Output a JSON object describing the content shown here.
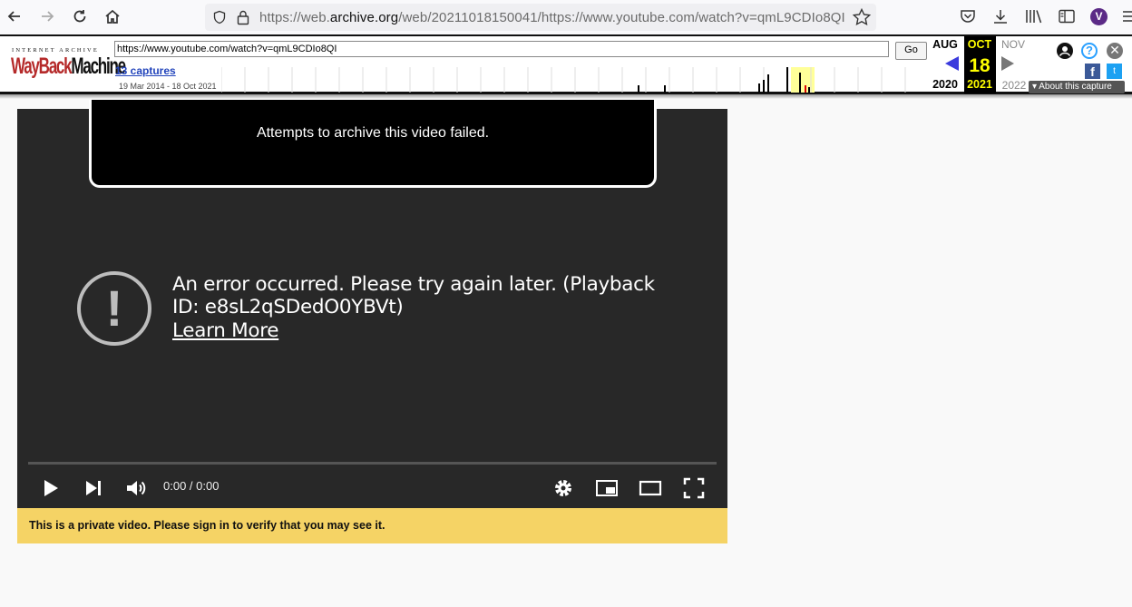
{
  "browser": {
    "url_prefix": "https://web.",
    "url_host": "archive.org",
    "url_rest": "/web/20211018150041/https://www.youtube.com/watch?v=qmL9CDIo8QI",
    "profile_initial": "V",
    "icons": [
      "back-icon",
      "forward-icon",
      "reload-icon",
      "home-icon",
      "shield-icon",
      "lock-icon",
      "bookmark-star-icon",
      "pocket-icon",
      "download-icon",
      "library-icon",
      "sidebar-icon",
      "menu-icon"
    ]
  },
  "wayback": {
    "logo_top": "INTERNET ARCHIVE",
    "logo_red": "WayBack",
    "logo_black": "Machine",
    "url_value": "https://www.youtube.com/watch?v=qmL9CDIo8QI",
    "go_label": "Go",
    "captures_label": "13 captures",
    "date_range": "19 Mar 2014 - 18 Oct 2021",
    "prev_month": "AUG",
    "cur_month": "OCT",
    "next_month": "NOV",
    "cur_day": "18",
    "prev_year": "2020",
    "cur_year": "2021",
    "next_year": "2022",
    "about_label": "About this capture",
    "help_glyph": "?",
    "close_glyph": "✕",
    "fb_glyph": "f",
    "tw_glyph": "t"
  },
  "player": {
    "fail_message": "Attempts to archive this video failed.",
    "error_icon_glyph": "!",
    "error_message": "An error occurred. Please try again later. (Playback ID: e8sL2qSDedO0YBVt)",
    "learn_more": "Learn More",
    "time": "0:00 / 0:00",
    "controls": [
      "play-icon",
      "next-icon",
      "volume-icon",
      "settings-icon",
      "miniplayer-icon",
      "theater-icon",
      "fullscreen-icon"
    ]
  },
  "notice": {
    "private_text": "This is a private video. Please sign in to verify that you may see it."
  }
}
